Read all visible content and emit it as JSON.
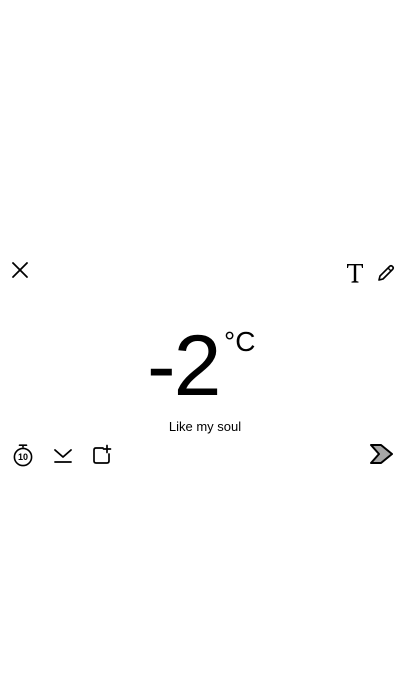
{
  "top_toolbar": {
    "close_icon": "close-icon",
    "text_tool_icon": "text-tool-icon",
    "pencil_tool_icon": "pencil-icon"
  },
  "main": {
    "temperature": "-2",
    "unit": "°C",
    "caption": "Like my soul"
  },
  "bottom_toolbar": {
    "timer_icon": "timer-icon",
    "timer_value": "10",
    "save_icon": "download-icon",
    "add_story_icon": "add-to-story-icon",
    "send_icon": "send-arrow-icon"
  },
  "colors": {
    "background": "#ffffff",
    "foreground": "#000000",
    "send_fill": "#a6a6a6"
  }
}
